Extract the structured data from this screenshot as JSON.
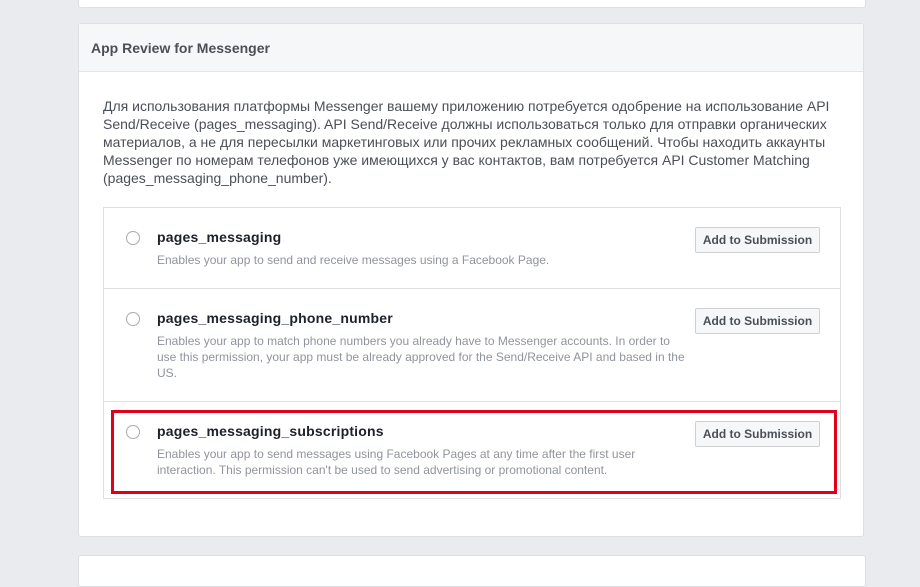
{
  "card": {
    "title": "App Review for Messenger",
    "intro": "Для использования платформы Messenger вашему приложению потребуется одобрение на использование API Send/Receive (pages_messaging). API Send/Receive должны использоваться только для отправки органических материалов, а не для пересылки маркетинговых или прочих рекламных сообщений. Чтобы находить аккаунты Messenger по номерам телефонов уже имеющихся у вас контактов, вам потребуется API Customer Matching (pages_messaging_phone_number)."
  },
  "permissions": [
    {
      "name": "pages_messaging",
      "description": "Enables your app to send and receive messages using a Facebook Page.",
      "button_label": "Add to Submission"
    },
    {
      "name": "pages_messaging_phone_number",
      "description": "Enables your app to match phone numbers you already have to Messenger accounts. In order to use this permission, your app must be already approved for the Send/Receive API and based in the US.",
      "button_label": "Add to Submission"
    },
    {
      "name": "pages_messaging_subscriptions",
      "description": "Enables your app to send messages using Facebook Pages at any time after the first user interaction. This permission can't be used to send advertising or promotional content.",
      "button_label": "Add to Submission"
    }
  ],
  "colors": {
    "highlight": "#e0001b",
    "page_background": "#e9ebee"
  }
}
